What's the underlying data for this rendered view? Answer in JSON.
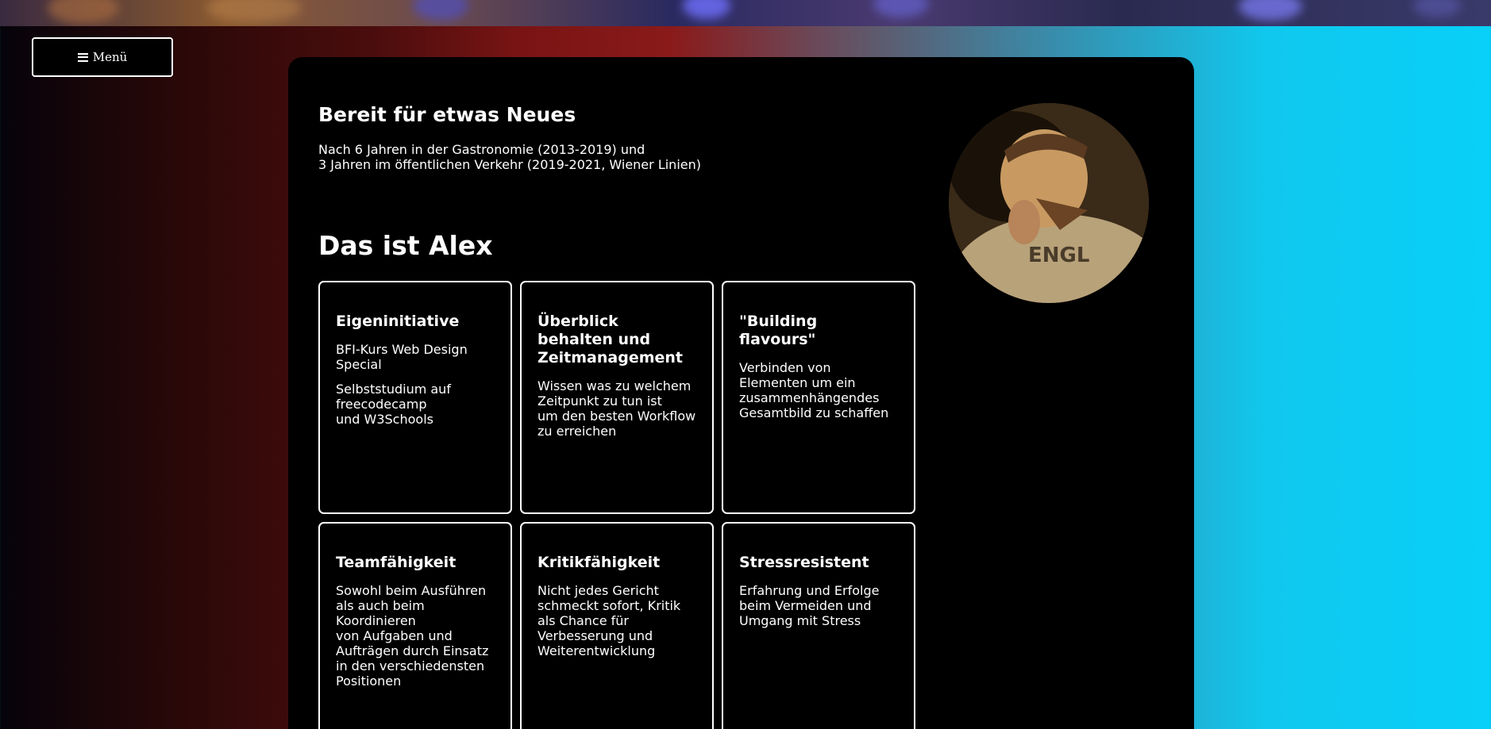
{
  "menu": {
    "label": "Menü",
    "icon": "hamburger-icon"
  },
  "hero": {
    "title": "Bereit für etwas Neues",
    "intro_line1": "Nach 6 Jahren in der Gastronomie (2013-2019) und",
    "intro_line2": "3 Jahren im öffentlichen Verkehr (2019-2021, Wiener Linien)"
  },
  "profile": {
    "heading": "Das ist Alex"
  },
  "cards": [
    {
      "title": "Eigeninitiative",
      "text1": "BFI-Kurs Web Design Special",
      "text2": "Selbststudium auf freecodecamp\nund W3Schools"
    },
    {
      "title": "Überblick behalten und Zeitmanagement",
      "text1": "Wissen was zu welchem Zeitpunkt zu tun ist\num den besten Workflow zu erreichen"
    },
    {
      "title": "\"Building flavours\"",
      "text1": "Verbinden von Elementen um ein zusammenhängendes Gesamtbild zu schaffen"
    },
    {
      "title": "Teamfähigkeit",
      "text1": "Sowohl beim Ausführen als auch beim Koordinieren\nvon Aufgaben und Aufträgen durch Einsatz in den verschiedensten Positionen"
    },
    {
      "title": "Kritikfähigkeit",
      "text1": "Nicht jedes Gericht schmeckt sofort, Kritik als Chance für Verbesserung und Weiterentwicklung"
    },
    {
      "title": "Stressresistent",
      "text1": "Erfahrung und Erfolge beim Vermeiden und Umgang mit Stress"
    }
  ]
}
